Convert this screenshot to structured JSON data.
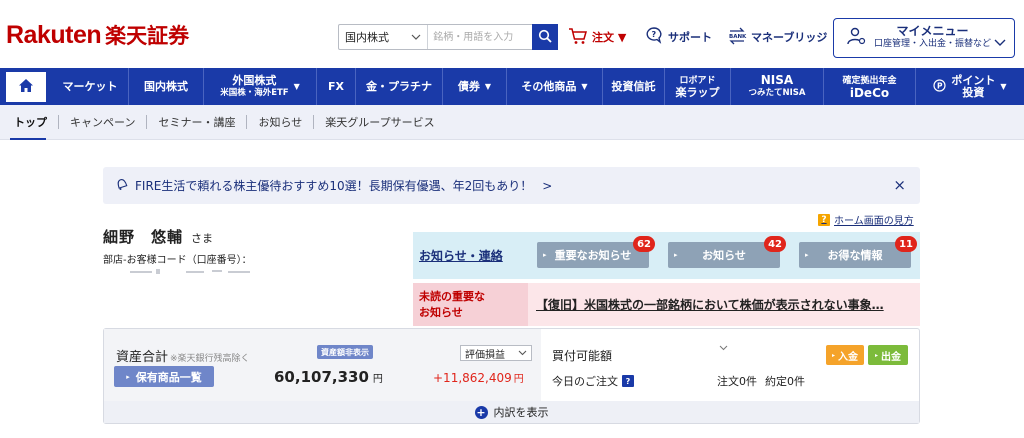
{
  "header": {
    "logo_en": "Rakuten",
    "logo_jp": "楽天証券",
    "search_select": "国内株式",
    "search_placeholder": "銘柄・用語を入力",
    "order_label": "注文 ▼",
    "support_label": "サポート",
    "bridge_label": "マネーブリッジ",
    "mymenu_title": "マイメニュー",
    "mymenu_sub": "口座管理・入出金・振替など"
  },
  "nav": {
    "items": [
      {
        "label": "マーケット"
      },
      {
        "label": "国内株式"
      },
      {
        "label": "外国株式",
        "sub": "米国株・海外ETF",
        "tri": "▼"
      },
      {
        "label": "FX"
      },
      {
        "label": "金・プラチナ"
      },
      {
        "label": "債券",
        "tri": "▼"
      },
      {
        "label": "その他商品",
        "tri": "▼"
      },
      {
        "label": "投資信託"
      },
      {
        "label": "ロボアド",
        "sub": "楽ラップ"
      },
      {
        "label": "NISA",
        "sub": "つみたてNISA"
      },
      {
        "label": "確定拠出年金",
        "sub": "iDeCo"
      },
      {
        "label": "ポイント",
        "sub": "投資",
        "tri": "▼"
      }
    ]
  },
  "subnav": {
    "items": [
      "トップ",
      "キャンペーン",
      "セミナー・講座",
      "お知らせ",
      "楽天グループサービス"
    ]
  },
  "banner": {
    "text": "FIRE生活で頼れる株主優待おすすめ10選！長期保有優遇、年2回もあり！",
    "arrow": ">",
    "close": "×"
  },
  "guide": {
    "label": "ホーム画面の見方",
    "icon_text": "?"
  },
  "user": {
    "name": "細野　悠輔",
    "honorific": "さま",
    "code_label": "部店-お客様コード（口座番号）："
  },
  "notice": {
    "label": "お知らせ・連絡",
    "buttons": [
      {
        "label": "重要なお知らせ",
        "badge": "62"
      },
      {
        "label": "お知らせ",
        "badge": "42"
      },
      {
        "label": "お得な情報",
        "badge": "11"
      }
    ]
  },
  "important": {
    "label_line1": "未読の重要な",
    "label_line2": "お知らせ",
    "message": "【復旧】米国株式の一部銘柄において株価が表示されない事象…"
  },
  "asset": {
    "title": "資産合計",
    "note": "※楽天銀行残高除く",
    "hide_label": "資産額非表示",
    "holdings_label": "保有商品一覧",
    "total": "60,107,330",
    "total_unit": "円",
    "eval_select": "評価損益",
    "gain": "+11,862,409",
    "gain_unit": "円",
    "buying_power_label": "買付可能額",
    "today_orders_label": "今日のご注文",
    "orders_count": "注文0件",
    "contracts_count": "約定0件",
    "deposit_label": "入金",
    "withdraw_label": "出金",
    "expand_label": "内訳を表示"
  },
  "colors": {
    "brand_red": "#bf0000",
    "nav_blue": "#1a3aa8",
    "gain_red": "#e0251b"
  }
}
